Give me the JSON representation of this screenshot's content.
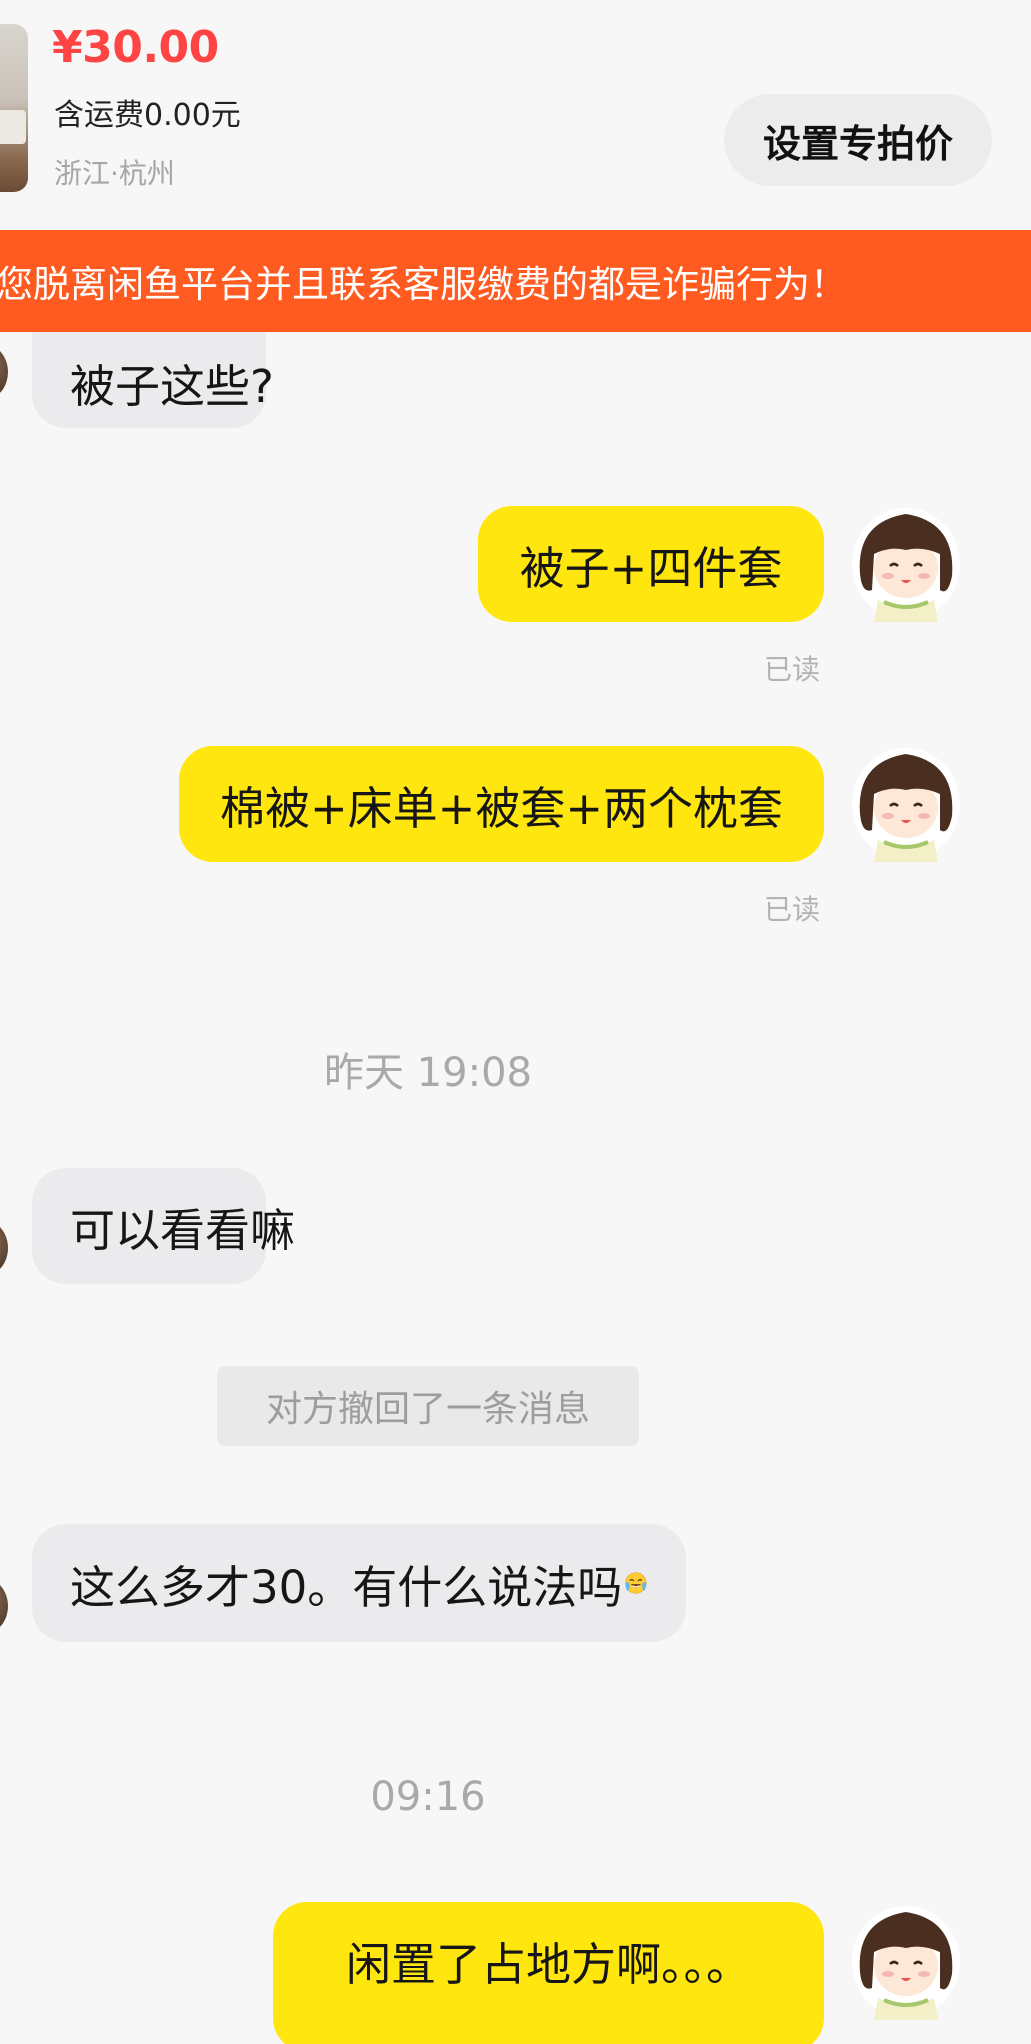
{
  "product": {
    "price": "¥30.00",
    "shipping": "含运费0.00元",
    "location": "浙江·杭州",
    "set_price_button": "设置专拍价"
  },
  "warning": {
    "text": "您脱离闲鱼平台并且联系客服缴费的都是诈骗行为！"
  },
  "messages": [
    {
      "side": "incoming",
      "text": "被子这些?"
    },
    {
      "side": "outgoing",
      "text": "被子+四件套",
      "status": "已读"
    },
    {
      "side": "outgoing",
      "text": "棉被+床单+被套+两个枕套",
      "status": "已读"
    },
    {
      "type": "time",
      "text": "昨天 19:08"
    },
    {
      "side": "incoming",
      "text": "可以看看嘛"
    },
    {
      "type": "system",
      "text": "对方撤回了一条消息"
    },
    {
      "side": "incoming",
      "text": "这么多才30。有什么说法吗",
      "emoji": "crying-laughing"
    },
    {
      "type": "time",
      "text": "09:16"
    },
    {
      "side": "outgoing",
      "text": "闲置了占地方啊。。。"
    }
  ],
  "colors": {
    "price_red": "#ff4444",
    "banner_orange": "#ff5a1f",
    "outgoing_bubble": "#ffe60f",
    "incoming_bubble": "#ebebed",
    "background": "#f7f7f7"
  }
}
